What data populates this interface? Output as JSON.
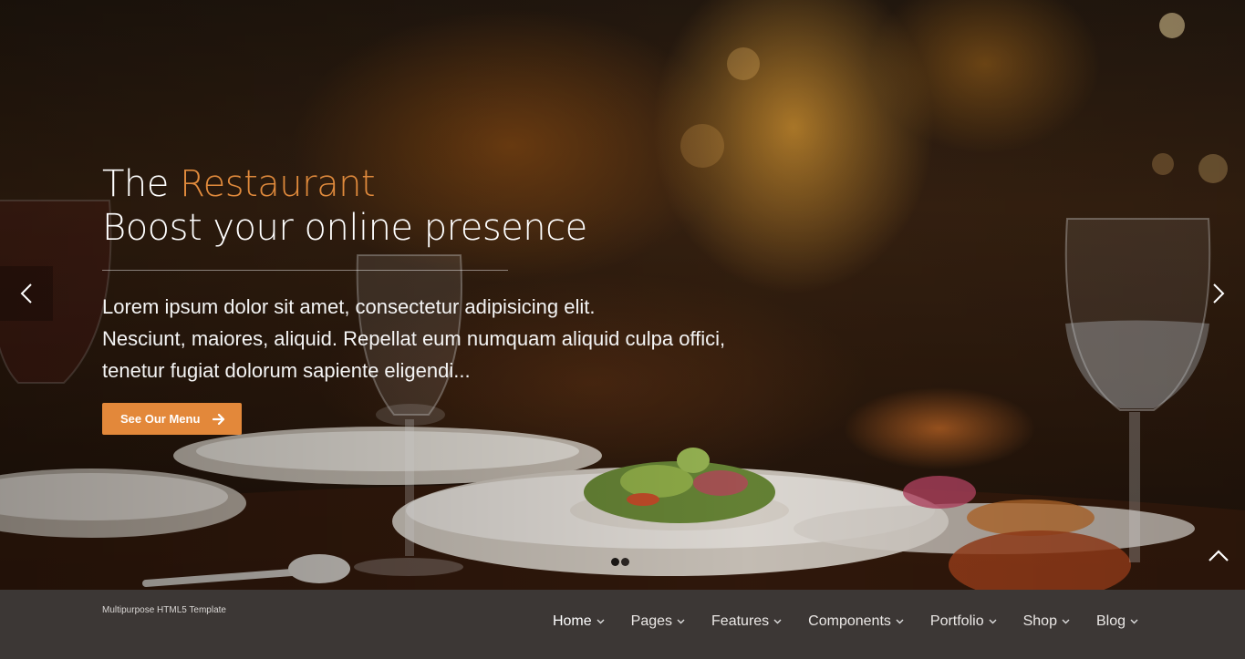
{
  "hero": {
    "title_prefix": "The",
    "title_accent": "Restaurant",
    "subtitle": "Boost your online presence",
    "description_lines": [
      "Lorem ipsum dolor sit amet, consectetur adipisicing elit.",
      "Nesciunt, maiores, aliquid. Repellat eum numquam aliquid culpa offici,",
      "tenetur fugiat dolorum sapiente eligendi..."
    ],
    "cta_label": "See Our Menu",
    "accent_color": "#e3883a",
    "slides_total": 2,
    "active_slide": 1,
    "icons": {
      "prev": "chevron-left-icon",
      "next": "chevron-right-icon",
      "cta": "arrow-right-icon",
      "to_top": "chevron-up-icon"
    }
  },
  "navbar": {
    "tagline": "Multipurpose HTML5 Template",
    "items": [
      {
        "label": "Home",
        "active": true
      },
      {
        "label": "Pages"
      },
      {
        "label": "Features"
      },
      {
        "label": "Components"
      },
      {
        "label": "Portfolio"
      },
      {
        "label": "Shop"
      },
      {
        "label": "Blog"
      }
    ]
  }
}
